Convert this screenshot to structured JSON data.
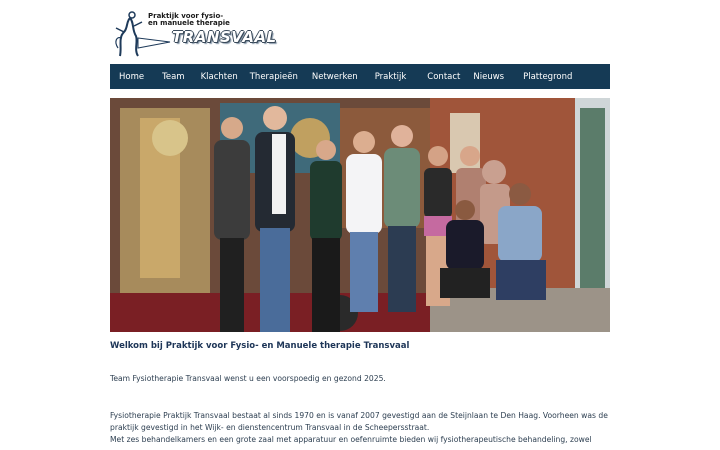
{
  "header": {
    "logo_line1": "Praktijk voor fysio-",
    "logo_line2": "en manuele therapie",
    "logo_word": "TRANSVAAL"
  },
  "nav": {
    "items": [
      {
        "label": "Home"
      },
      {
        "label": "Team"
      },
      {
        "label": "Klachten"
      },
      {
        "label": "Therapieën"
      },
      {
        "label": "Netwerken"
      },
      {
        "label": "Praktijk"
      },
      {
        "label": "Contact"
      },
      {
        "label": "Nieuws"
      },
      {
        "label": "Plattegrond"
      }
    ]
  },
  "main": {
    "welcome_title": "Welkom bij Praktijk voor Fysio- en Manuele therapie Transvaal",
    "greeting": "Team Fysiotherapie Transvaal wenst u een voorspoedig en gezond 2025.",
    "about_lines": [
      "Fysiotherapie Praktijk Transvaal bestaat al sinds 1970 en is vanaf 2007 gevestigd aan de Steijnlaan te Den Haag. Voorheen was de",
      "praktijk gevestigd in het Wijk- en dienstencentrum Transvaal in de Scheepersstraat.",
      "Met zes behandelkamers en een grote zaal met apparatuur en oefenruimte bieden wij fysiotherapeutische behandeling, zowel"
    ]
  },
  "colors": {
    "nav_background": "#153a55",
    "heading": "#1d3557",
    "body_text": "#2c3e50"
  }
}
